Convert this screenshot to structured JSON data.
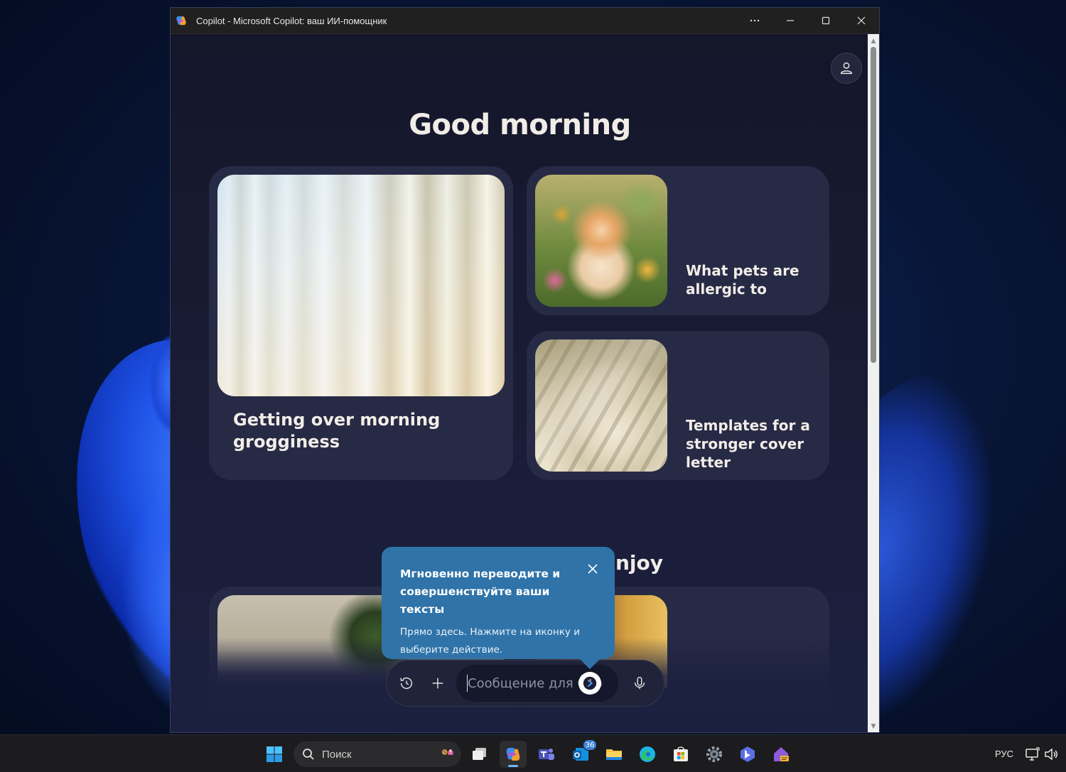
{
  "window": {
    "title": "Copilot - Microsoft Copilot: ваш ИИ-помощник"
  },
  "main": {
    "greeting": "Good morning",
    "cards": [
      {
        "text": "Getting over morning grogginess"
      },
      {
        "text": "What pets are allergic to"
      },
      {
        "text": "Templates for a stronger cover letter"
      }
    ],
    "section2_title": "njoy"
  },
  "tooltip": {
    "title": "Мгновенно переводите и совершенствуйте ваши тексты",
    "body": "Прямо здесь. Нажмите на иконку и выберите действие."
  },
  "composer": {
    "placeholder": "Сообщение для Copilot"
  },
  "taskbar": {
    "search_label": "Поиск",
    "mail_badge": "36",
    "language": "РУС"
  },
  "colors": {
    "accent": "#2f73a8",
    "card_bg": "#272a45",
    "page_bg": "#1a1d34",
    "taskbar_bg": "#1c1c1e"
  }
}
